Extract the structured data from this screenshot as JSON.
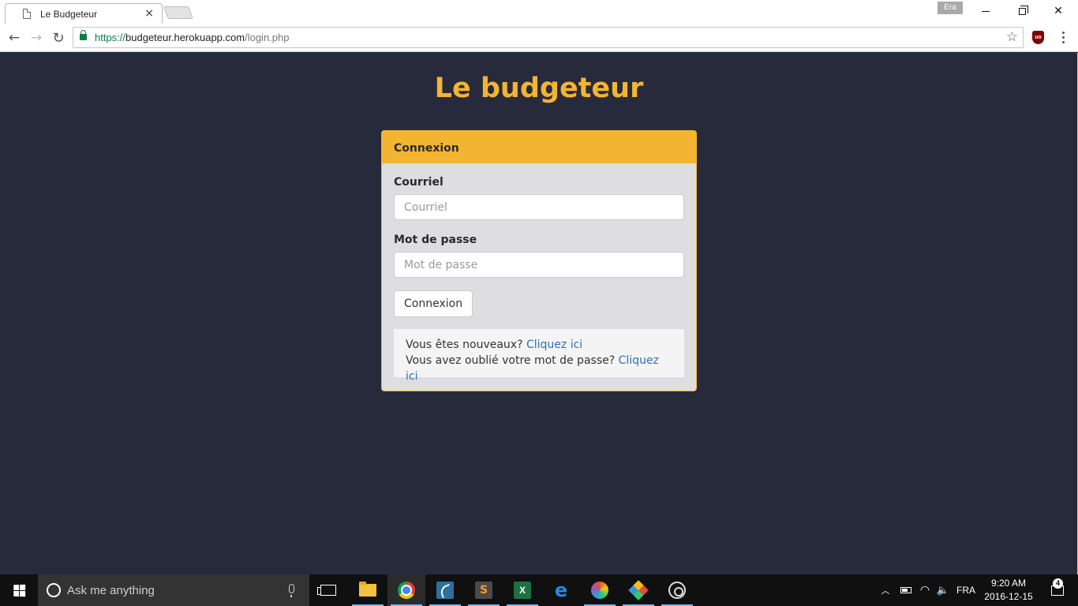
{
  "browser": {
    "tab_title": "Le Budgeteur",
    "tab_close": "×",
    "profile_name": "Era",
    "url_scheme": "https://",
    "url_host": "budgeteur.herokuapp.com",
    "url_path": "/login.php",
    "extension_label": "uo",
    "icons": [
      "document-icon",
      "back-icon",
      "forward-icon",
      "reload-icon",
      "lock-icon",
      "star-icon",
      "ublock-icon",
      "menu-icon",
      "minimize-icon",
      "restore-icon",
      "close-icon"
    ]
  },
  "page": {
    "title": "Le budgeteur",
    "login_panel": {
      "heading": "Connexion",
      "email_label": "Courriel",
      "email_placeholder": "Courriel",
      "email_value": "",
      "password_label": "Mot de passe",
      "password_placeholder": "Mot de passe",
      "password_value": "",
      "submit_label": "Connexion",
      "new_user_text": "Vous êtes nouveaux?",
      "new_user_link": "Cliquez ici",
      "forgot_text": "Vous avez oublié votre mot de passe?",
      "forgot_link": "Cliquez ici"
    }
  },
  "colors": {
    "background": "#262a3b",
    "accent": "#f3b431",
    "panel_body": "#dedde0",
    "link": "#2f70b0"
  },
  "taskbar": {
    "search_placeholder": "Ask me anything",
    "apps": [
      "task-view",
      "file-explorer",
      "google-chrome",
      "mysql-workbench",
      "sublime-text",
      "excel",
      "edge",
      "paint",
      "git",
      "obs"
    ],
    "sublime_letter": "S",
    "excel_letter": "X",
    "edge_letter": "e",
    "language": "FRA",
    "time": "9:20 AM",
    "date": "2016-12-15",
    "notification_count": "4"
  }
}
